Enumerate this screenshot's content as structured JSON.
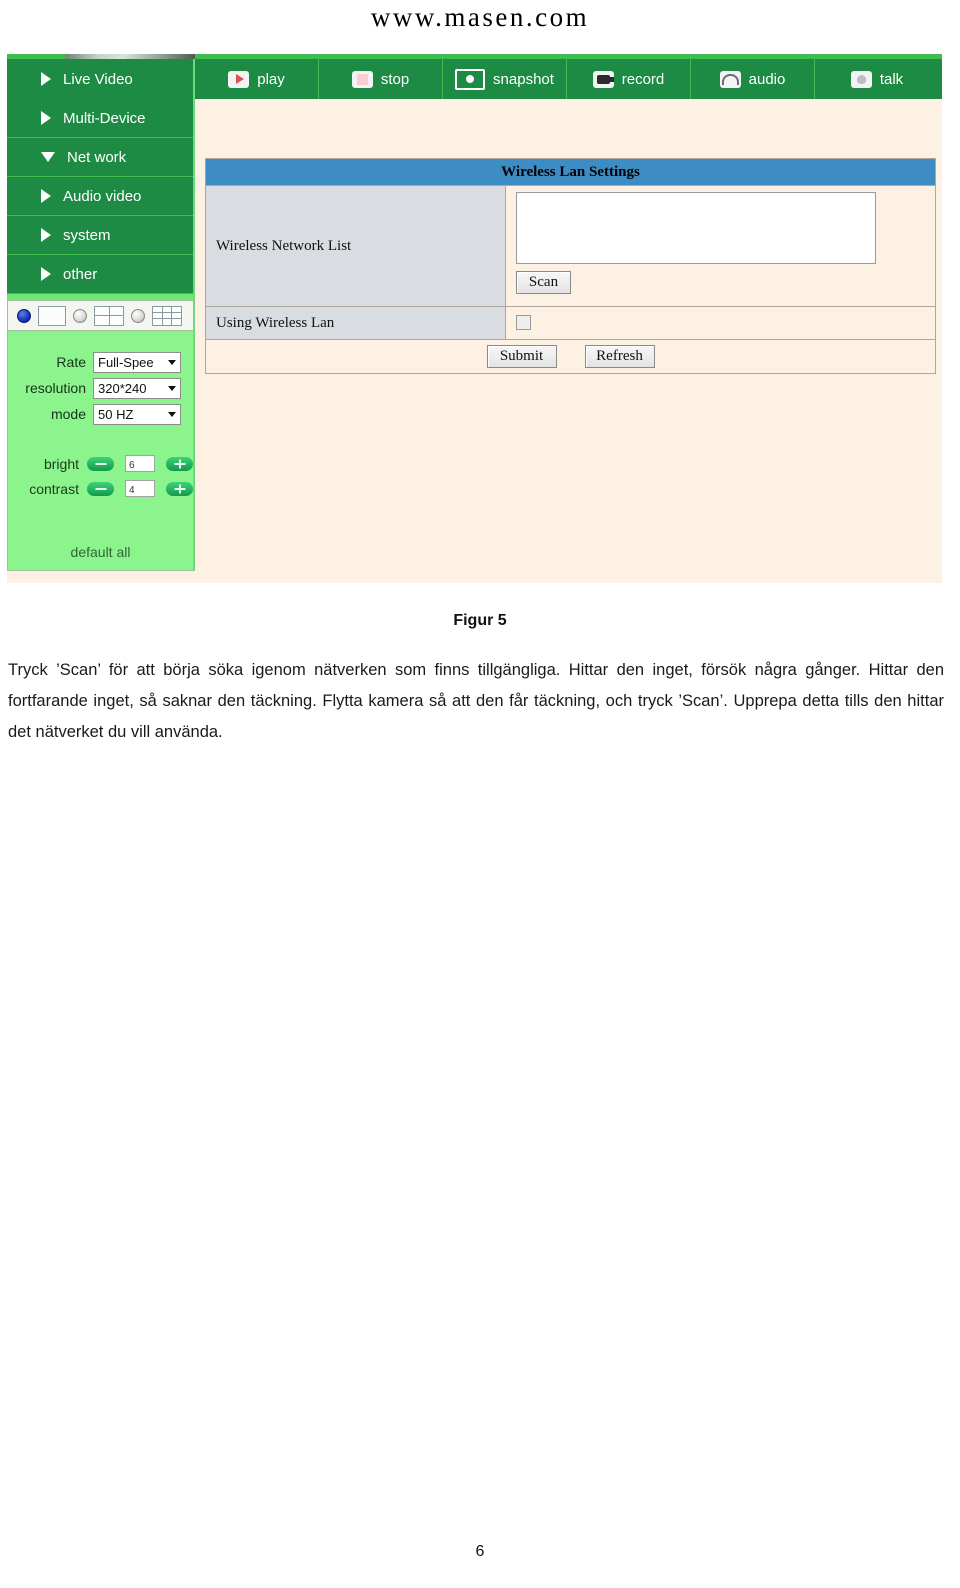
{
  "document": {
    "site_header": "www.masen.com",
    "figure_caption": "Figur 5",
    "body_text": "Tryck ’Scan’ för att börja söka igenom nätverken som finns tillgängliga. Hittar den inget, försök några gånger. Hittar den fortfarande inget, så saknar den täckning. Flytta kamera så att den får täckning, och tryck ’Scan’. Upprepa detta tills den hittar det nätverket du vill använda.",
    "page_number": "6"
  },
  "screenshot": {
    "toolbar": {
      "live_video": {
        "label": "Live Video",
        "icon": "triangle-right-icon"
      },
      "buttons": [
        {
          "label": "play",
          "icon": "play-icon"
        },
        {
          "label": "stop",
          "icon": "stop-icon"
        },
        {
          "label": "snapshot",
          "icon": "snapshot-icon"
        },
        {
          "label": "record",
          "icon": "record-icon"
        },
        {
          "label": "audio",
          "icon": "audio-icon"
        },
        {
          "label": "talk",
          "icon": "talk-icon"
        }
      ]
    },
    "sidebar": {
      "nav_items": [
        {
          "label": "Multi-Device",
          "icon": "triangle-right-icon",
          "expanded": false
        },
        {
          "label": "Net work",
          "icon": "triangle-down-icon",
          "expanded": true
        },
        {
          "label": "Audio video",
          "icon": "triangle-right-icon",
          "expanded": false
        },
        {
          "label": "system",
          "icon": "triangle-right-icon",
          "expanded": false
        },
        {
          "label": "other",
          "icon": "triangle-right-icon",
          "expanded": false
        }
      ],
      "view_modes": [
        {
          "name": "radio-single",
          "selected": true
        },
        {
          "name": "pane-1",
          "selected": false
        },
        {
          "name": "radio-quad",
          "selected": false
        },
        {
          "name": "pane-4",
          "selected": false
        },
        {
          "name": "radio-nine",
          "selected": false
        },
        {
          "name": "pane-9",
          "selected": false
        }
      ],
      "settings": {
        "rate_label": "Rate",
        "rate_value": "Full-Spee",
        "resolution_label": "resolution",
        "resolution_value": "320*240",
        "mode_label": "mode",
        "mode_value": "50 HZ",
        "bright_label": "bright",
        "bright_value": "6",
        "contrast_label": "contrast",
        "contrast_value": "4",
        "minus_label": "−",
        "plus_label": "+",
        "default_all": "default all"
      }
    },
    "main": {
      "card_title": "Wireless Lan Settings",
      "wireless_network_list_label": "Wireless Network List",
      "wireless_network_list_value": "",
      "scan_button": "Scan",
      "using_wireless_lan_label": "Using Wireless Lan",
      "using_wireless_lan_checked": false,
      "submit_button": "Submit",
      "refresh_button": "Refresh"
    }
  },
  "colors": {
    "sidebar_green": "#1e8b45",
    "accent_green": "#3fbe4f",
    "settings_green": "#8cf48c",
    "card_header_blue": "#3d8cc4",
    "panel_cream": "#fdf1e3",
    "label_gray": "#d9dde2"
  }
}
